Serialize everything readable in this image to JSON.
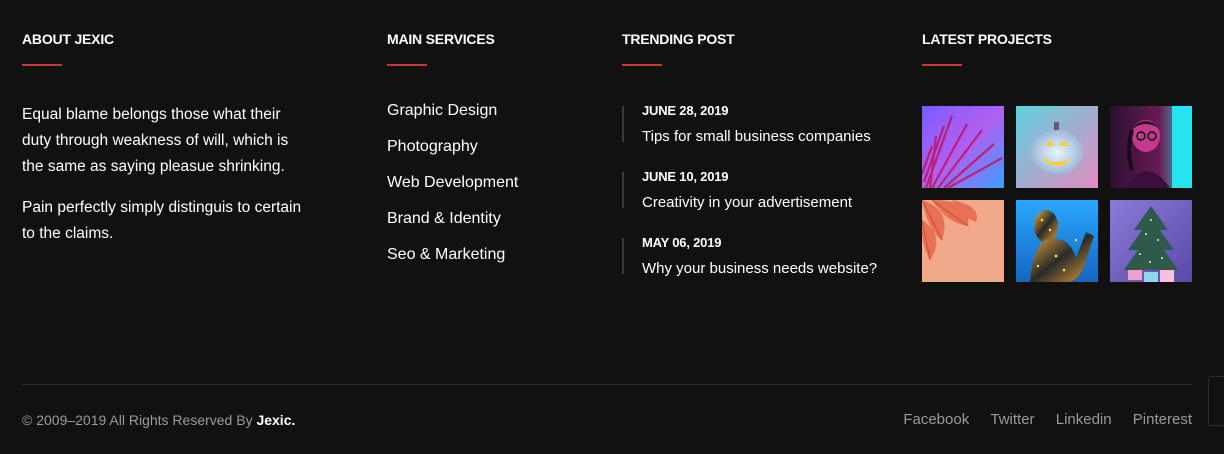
{
  "about": {
    "heading": "ABOUT JEXIC",
    "paragraph1": "Equal blame belongs those what their duty through weakness of will, which is the same as saying pleasue shrinking.",
    "paragraph2": "Pain perfectly simply distinguis to certain to the claims."
  },
  "services": {
    "heading": "MAIN SERVICES",
    "items": [
      {
        "label": "Graphic Design"
      },
      {
        "label": "Photography"
      },
      {
        "label": "Web Development"
      },
      {
        "label": "Brand & Identity"
      },
      {
        "label": "Seo & Marketing"
      }
    ]
  },
  "trending": {
    "heading": "TRENDING POST",
    "posts": [
      {
        "date": "JUNE 28, 2019",
        "title": "Tips for small business companies"
      },
      {
        "date": "JUNE 10, 2019",
        "title": "Creativity in your advertisement"
      },
      {
        "date": "MAY 06, 2019",
        "title": "Why your business needs website?"
      }
    ]
  },
  "projects": {
    "heading": "LATEST PROJECTS"
  },
  "footer": {
    "copyright_prefix": "© 2009–2019 All Rights Reserved By ",
    "brand": "Jexic.",
    "social": [
      {
        "label": "Facebook"
      },
      {
        "label": "Twitter"
      },
      {
        "label": "Linkedin"
      },
      {
        "label": "Pinterest"
      }
    ]
  },
  "colors": {
    "background": "#111111",
    "accent": "#d0323a",
    "muted_text": "#9a9a9a"
  }
}
